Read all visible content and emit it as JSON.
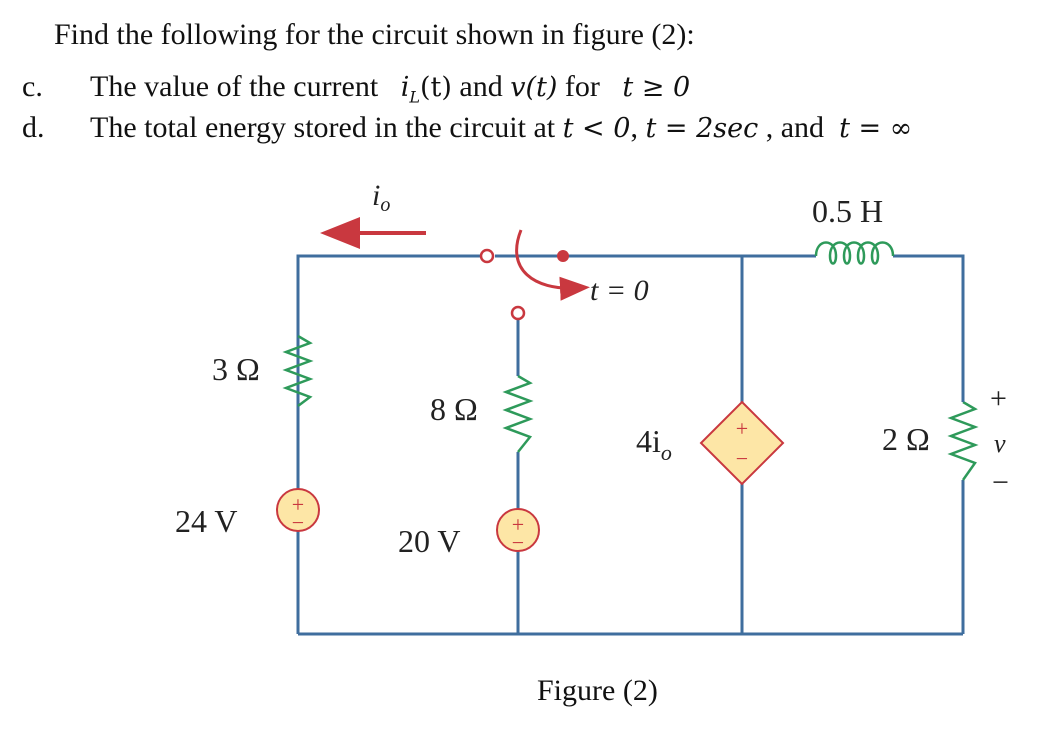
{
  "problem": {
    "intro": "Find the following for the circuit shown in figure (2):",
    "items": [
      {
        "marker": "c.",
        "text_before": "The value of the current",
        "var1": "i",
        "var1_sub": "L",
        "var1_arg": "(t)",
        "conjunction": "and",
        "var2": "v(t)",
        "for_word": "for",
        "condition": "t ≥ 0"
      },
      {
        "marker": "d.",
        "text_before": "The total energy stored in the circuit at",
        "t1": "t < 0",
        "sep1": ",",
        "t2": "t = 2sec",
        "sep2": ", and",
        "t3": "t = ∞"
      }
    ]
  },
  "figure": {
    "caption": "Figure (2)",
    "current_label": "i",
    "current_sub": "o",
    "switch_label": "t = 0",
    "inductor_label": "0.5 H",
    "r1_label": "3 Ω",
    "r2_label": "8 Ω",
    "r3_label": "2 Ω",
    "v1_label": "24 V",
    "v2_label": "20 V",
    "dep_source_label": "4i",
    "dep_source_sub": "o",
    "plus_sign": "+",
    "minus_sign": "−",
    "v_label": "v",
    "colors": {
      "wire": "#3f6e9e",
      "component": "#2e9a5a",
      "source_fill": "#fde6a6",
      "source_stroke": "#c9383f",
      "arrow": "#c9383f"
    }
  }
}
